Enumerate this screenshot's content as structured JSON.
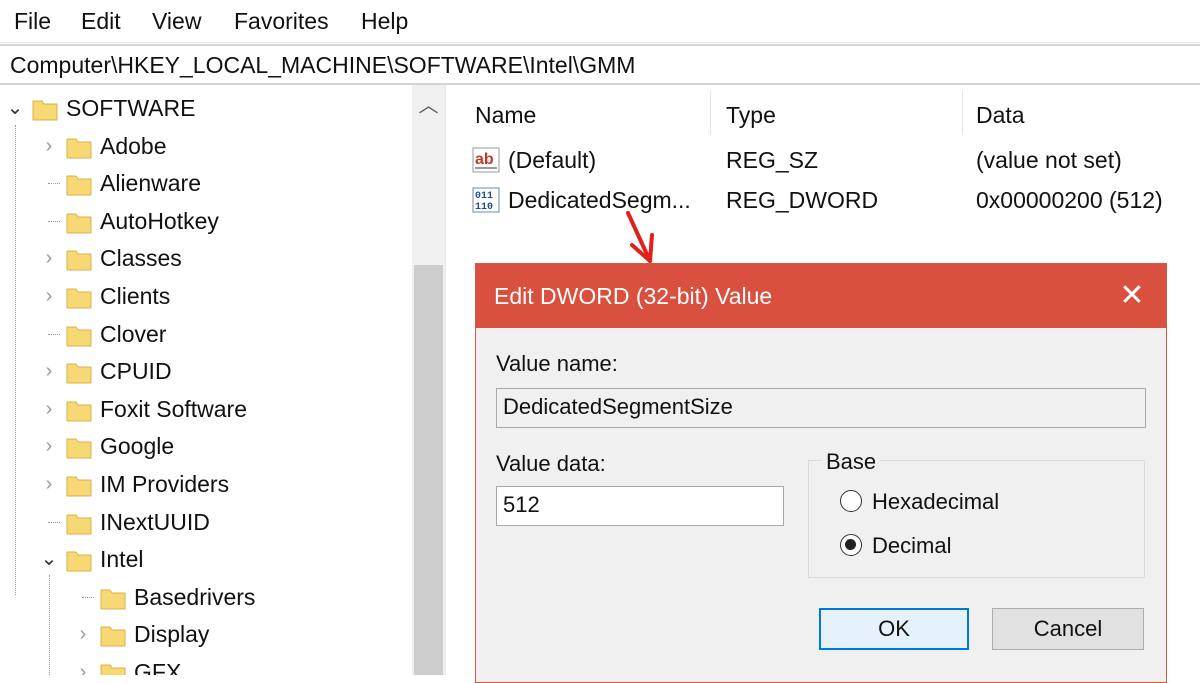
{
  "menu": [
    "File",
    "Edit",
    "View",
    "Favorites",
    "Help"
  ],
  "address": "Computer\\HKEY_LOCAL_MACHINE\\SOFTWARE\\Intel\\GMM",
  "tree": {
    "items": [
      {
        "label": "SOFTWARE",
        "state": "expanded"
      },
      {
        "label": "Adobe",
        "state": "collapsed"
      },
      {
        "label": "Alienware",
        "state": "leaf"
      },
      {
        "label": "AutoHotkey",
        "state": "leaf"
      },
      {
        "label": "Classes",
        "state": "collapsed"
      },
      {
        "label": "Clients",
        "state": "collapsed"
      },
      {
        "label": "Clover",
        "state": "leaf"
      },
      {
        "label": "CPUID",
        "state": "collapsed"
      },
      {
        "label": "Foxit Software",
        "state": "collapsed"
      },
      {
        "label": "Google",
        "state": "collapsed"
      },
      {
        "label": "IM Providers",
        "state": "collapsed"
      },
      {
        "label": "INextUUID",
        "state": "leaf"
      },
      {
        "label": "Intel",
        "state": "expanded"
      },
      {
        "label": "Basedrivers",
        "state": "leaf"
      },
      {
        "label": "Display",
        "state": "collapsed"
      },
      {
        "label": "GFX",
        "state": "collapsed"
      }
    ]
  },
  "values": {
    "headers": [
      "Name",
      "Type",
      "Data"
    ],
    "rows": [
      {
        "icon": "string-value-icon",
        "name": "(Default)",
        "type": "REG_SZ",
        "data": "(value not set)"
      },
      {
        "icon": "binary-value-icon",
        "name": "DedicatedSegm...",
        "type": "REG_DWORD",
        "data": "0x00000200 (512)"
      }
    ]
  },
  "dialog": {
    "title": "Edit DWORD (32-bit) Value",
    "close_glyph": "✕",
    "value_name_label": "Value name:",
    "value_name": "DedicatedSegmentSize",
    "value_data_label": "Value data:",
    "value_data": "512",
    "base_label": "Base",
    "hex_label": "Hexadecimal",
    "dec_label": "Decimal",
    "selected_base": "Decimal",
    "ok_label": "OK",
    "cancel_label": "Cancel"
  },
  "colors": {
    "dialog_title_bar": "#d9503e",
    "annotation_arrow": "#e0201a",
    "folder": "#f8d775"
  }
}
